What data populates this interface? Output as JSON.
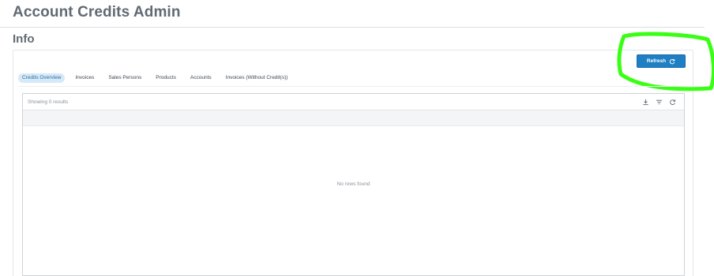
{
  "page": {
    "title": "Account Credits Admin"
  },
  "section": {
    "title": "Info"
  },
  "toolbar": {
    "refresh_label": "Refresh"
  },
  "tabs": [
    {
      "label": "Credits Overview",
      "active": true
    },
    {
      "label": "Invoices",
      "active": false
    },
    {
      "label": "Sales Persons",
      "active": false
    },
    {
      "label": "Products",
      "active": false
    },
    {
      "label": "Accounts",
      "active": false
    },
    {
      "label": "Invoices (Without Credit(s))",
      "active": false
    }
  ],
  "grid": {
    "result_count": "Showing 0 results",
    "empty_message": "No rows found",
    "tools": [
      "download-icon",
      "filter-icon",
      "reload-icon"
    ]
  },
  "icons": {
    "refresh": "refresh-icon"
  },
  "colors": {
    "accent": "#1f7fc4",
    "active_tab_bg": "#d6e9f9",
    "annotation": "#39ff14"
  }
}
